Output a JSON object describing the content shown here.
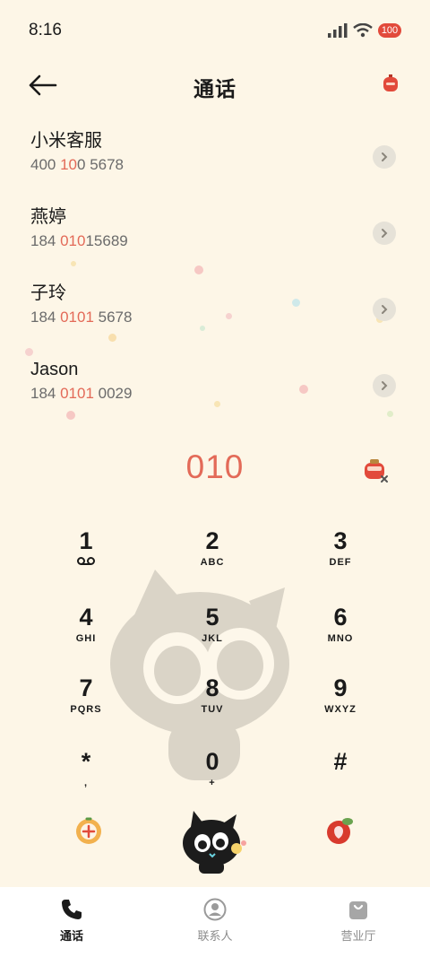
{
  "status_bar": {
    "time": "8:16",
    "battery": "100"
  },
  "header": {
    "title": "通话"
  },
  "contacts": [
    {
      "name": "小米客服",
      "num_parts": [
        "400 ",
        "10",
        "0 5678"
      ]
    },
    {
      "name": "燕婷",
      "num_parts": [
        "184 ",
        "010",
        "15689"
      ]
    },
    {
      "name": "子玲",
      "num_parts": [
        "184 ",
        "0101",
        " 5678"
      ]
    },
    {
      "name": "Jason",
      "num_parts": [
        "184 ",
        "0101",
        " 0029"
      ]
    }
  ],
  "dial": {
    "input": "010"
  },
  "keypad": [
    {
      "digit": "1",
      "sub": ""
    },
    {
      "digit": "2",
      "sub": "ABC"
    },
    {
      "digit": "3",
      "sub": "DEF"
    },
    {
      "digit": "4",
      "sub": "GHI"
    },
    {
      "digit": "5",
      "sub": "JKL"
    },
    {
      "digit": "6",
      "sub": "MNO"
    },
    {
      "digit": "7",
      "sub": "PQRS"
    },
    {
      "digit": "8",
      "sub": "TUV"
    },
    {
      "digit": "9",
      "sub": "WXYZ"
    },
    {
      "digit": "*",
      "sub": ","
    },
    {
      "digit": "0",
      "sub": "+"
    },
    {
      "digit": "#",
      "sub": ""
    }
  ],
  "tabs": [
    {
      "label": "通话",
      "icon": "phone-icon",
      "active": true
    },
    {
      "label": "联系人",
      "icon": "contact-icon",
      "active": false
    },
    {
      "label": "营业厅",
      "icon": "bag-icon",
      "active": false
    }
  ],
  "colors": {
    "accent": "#e36a58",
    "background": "#fdf6e7"
  }
}
